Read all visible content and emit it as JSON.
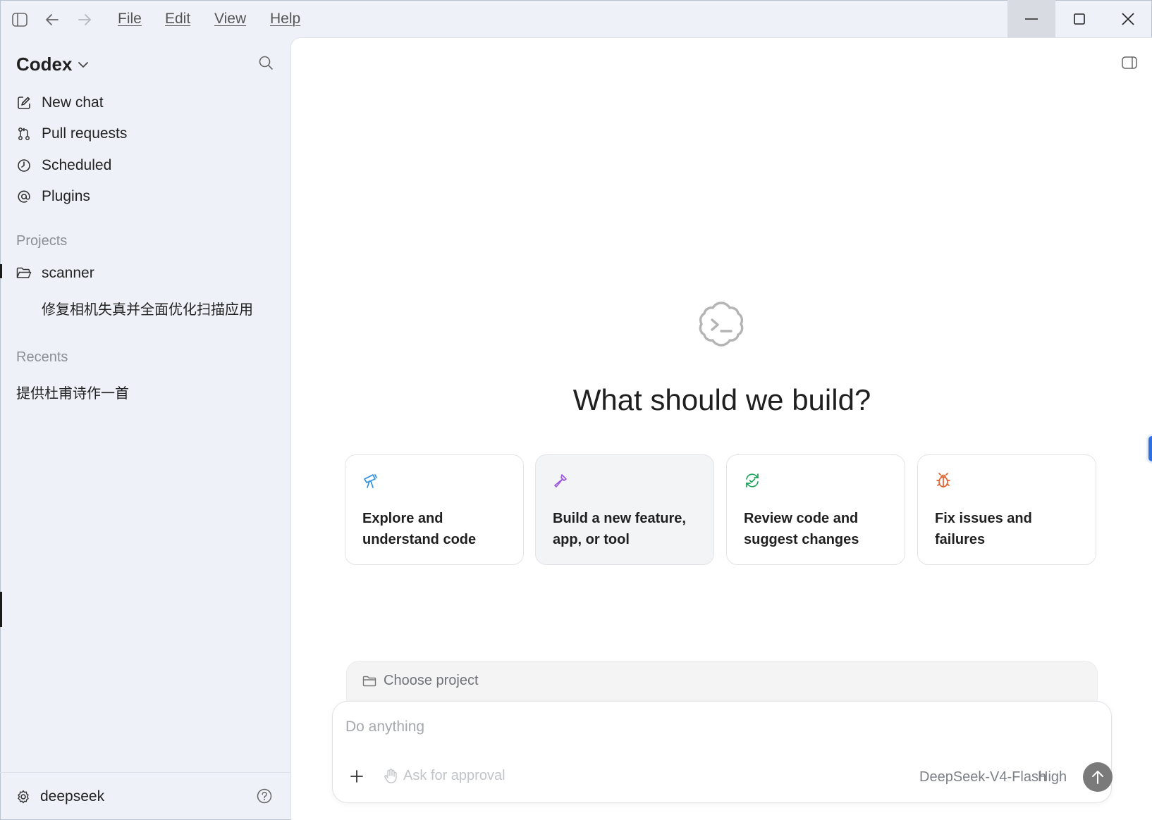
{
  "menu": {
    "file": "File",
    "edit": "Edit",
    "view": "View",
    "help": "Help"
  },
  "sidebar": {
    "brand": "Codex",
    "nav": [
      {
        "label": "New chat",
        "icon": "edit-icon"
      },
      {
        "label": "Pull requests",
        "icon": "pull-request-icon"
      },
      {
        "label": "Scheduled",
        "icon": "clock-icon"
      },
      {
        "label": "Plugins",
        "icon": "at-sign-icon"
      }
    ],
    "projects_label": "Projects",
    "project": {
      "name": "scanner",
      "thread": "修复相机失真并全面优化扫描应用"
    },
    "recents_label": "Recents",
    "recent": "提供杜甫诗作一首",
    "user": "deepseek"
  },
  "main": {
    "headline": "What should we build?",
    "cards": [
      {
        "line1": "Explore and",
        "line2": "understand code",
        "icon": "telescope-icon",
        "color": "#2f8fe0"
      },
      {
        "line1": "Build a new feature,",
        "line2": "app, or tool",
        "icon": "hammer-icon",
        "color": "#9b59e0"
      },
      {
        "line1": "Review code and",
        "line2": "suggest changes",
        "icon": "review-sync-icon",
        "color": "#1fa35a"
      },
      {
        "line1": "",
        "line2": "Fix issues and failures",
        "icon": "bug-icon",
        "color": "#e0622f"
      }
    ],
    "choose_project": "Choose project",
    "composer": {
      "placeholder": "Do anything",
      "approval": "Ask for approval",
      "model": "DeepSeek-V4-Flash",
      "effort": "High"
    }
  }
}
